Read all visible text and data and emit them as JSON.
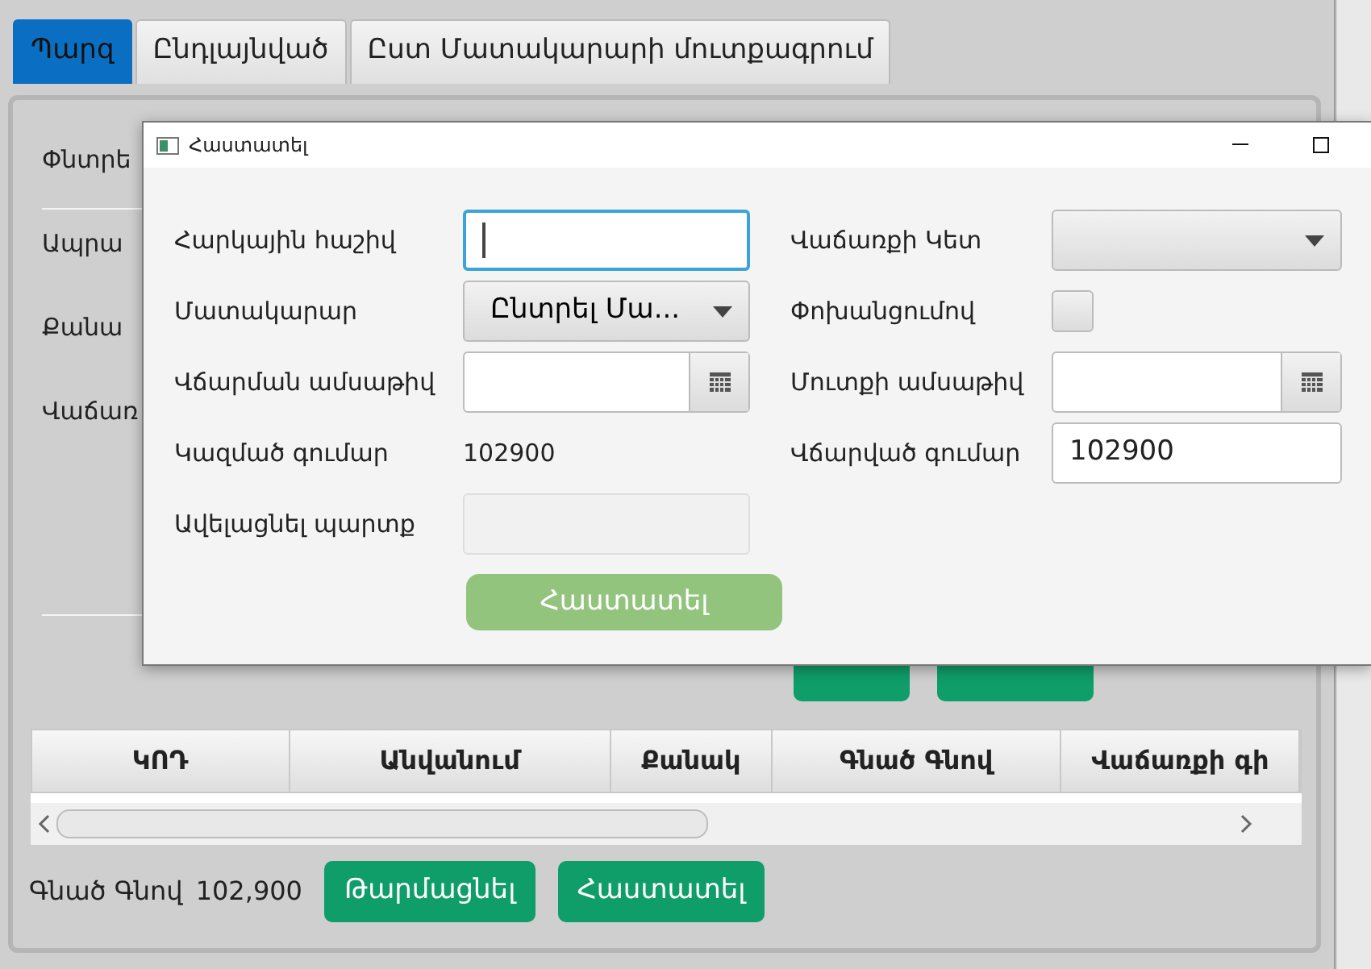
{
  "tabs": [
    {
      "label": "Պարզ",
      "selected": true
    },
    {
      "label": "Ընդլայնված",
      "selected": false
    },
    {
      "label": "Ըստ Մատակարարի մուտքագրում",
      "selected": false
    }
  ],
  "form_labels": [
    "Փնտրե",
    "Ապրա",
    "Քանա",
    "Վաճառ"
  ],
  "table": {
    "columns": [
      "ԿՈԴ",
      "Անվանում",
      "Քանակ",
      "Գնած Գնով",
      "Վաճառքի գի"
    ]
  },
  "footer": {
    "label": "Գնած Գնով",
    "value": "102,900",
    "buttons": [
      "Թարմացնել",
      "Հաստատել"
    ]
  },
  "dialog": {
    "title": "Հաստատել",
    "left_fields": [
      {
        "kind": "text",
        "label": "Հարկային հաշիվ",
        "focused": true,
        "disabled": false
      },
      {
        "kind": "select",
        "label": "Մատակարար",
        "value": "Ընտրել Մա..."
      },
      {
        "kind": "date",
        "label": "Վճարման ամսաթիվ"
      },
      {
        "kind": "static",
        "label": "Կազմած գումար",
        "value": "102900"
      },
      {
        "kind": "text",
        "label": "Ավելացնել պարտք",
        "focused": false,
        "disabled": true
      }
    ],
    "right_fields": [
      {
        "kind": "select",
        "label": "Վաճառքի Կետ"
      },
      {
        "kind": "checkbox",
        "label": "Փոխանցումով",
        "checked": false
      },
      {
        "kind": "date",
        "label": "Մուտքի ամսաթիվ"
      },
      {
        "kind": "text",
        "label": "Վճարված գումար",
        "value": "102900",
        "focused": false,
        "disabled": false
      }
    ],
    "button": {
      "label": "Հաստատել",
      "disabled": true
    }
  }
}
